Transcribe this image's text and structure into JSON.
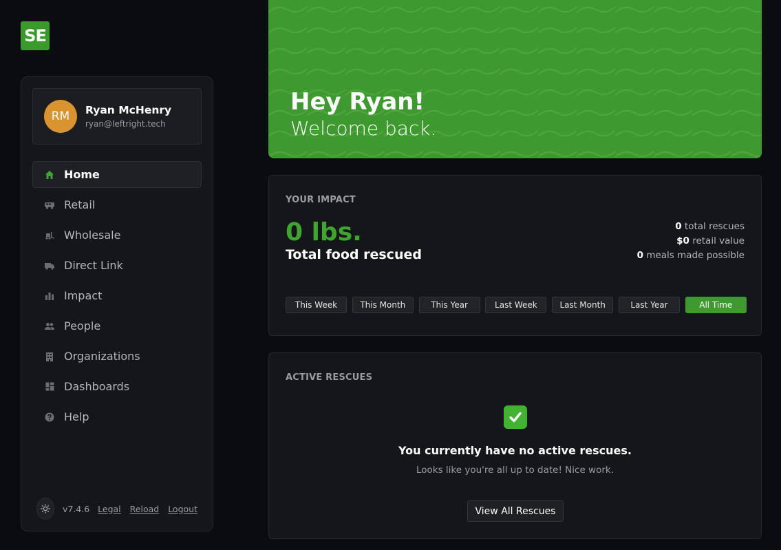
{
  "logo": {
    "text": "SE",
    "color": "#3b9a2c"
  },
  "user": {
    "initials": "RM",
    "name": "Ryan McHenry",
    "email": "ryan@leftright.tech",
    "avatar_color": "#d9942f"
  },
  "nav": {
    "items": [
      {
        "label": "Home",
        "icon": "home-icon",
        "active": true
      },
      {
        "label": "Retail",
        "icon": "van-icon"
      },
      {
        "label": "Wholesale",
        "icon": "forklift-icon"
      },
      {
        "label": "Direct Link",
        "icon": "truck-icon"
      },
      {
        "label": "Impact",
        "icon": "bar-chart-icon"
      },
      {
        "label": "People",
        "icon": "people-icon"
      },
      {
        "label": "Organizations",
        "icon": "building-icon"
      },
      {
        "label": "Dashboards",
        "icon": "dashboard-icon"
      },
      {
        "label": "Help",
        "icon": "help-icon"
      }
    ]
  },
  "footer": {
    "theme_icon": "sun-icon",
    "version": "v7.4.6",
    "legal": "Legal",
    "reload": "Reload",
    "logout": "Logout"
  },
  "hero": {
    "greeting": "Hey Ryan!",
    "subtitle": "Welcome back.",
    "color": "#3e9a2f"
  },
  "impact": {
    "title": "YOUR IMPACT",
    "value": "0 lbs.",
    "label": "Total food rescued",
    "stats": [
      {
        "value": "0",
        "label": " total rescues"
      },
      {
        "value": "$0",
        "label": " retail value"
      },
      {
        "value": "0",
        "label": " meals made possible"
      }
    ],
    "ranges": [
      "This Week",
      "This Month",
      "This Year",
      "Last Week",
      "Last Month",
      "Last Year",
      "All Time"
    ],
    "active_range": "All Time",
    "accent": "#3fa530"
  },
  "rescues": {
    "title": "ACTIVE RESCUES",
    "icon": "check-mark-icon",
    "empty_title": "You currently have no active rescues.",
    "empty_sub": "Looks like you're all up to date! Nice work.",
    "button": "View All Rescues"
  }
}
